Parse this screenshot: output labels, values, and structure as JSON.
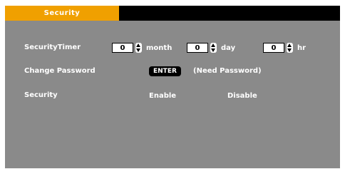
{
  "tab": {
    "label": "Security"
  },
  "rows": {
    "security_timer": {
      "label": "SecurityTimer",
      "month": {
        "value": "0",
        "unit": "month"
      },
      "day": {
        "value": "0",
        "unit": "day"
      },
      "hour": {
        "value": "0",
        "unit": "hr"
      }
    },
    "change_password": {
      "label": "Change Password",
      "button": "ENTER",
      "note": "(Need Password)"
    },
    "security": {
      "label": "Security",
      "enable": "Enable",
      "disable": "Disable"
    }
  },
  "colors": {
    "tab_active": "#f0a000",
    "panel_bg": "#8a8a8a",
    "header_bg": "#000000"
  }
}
